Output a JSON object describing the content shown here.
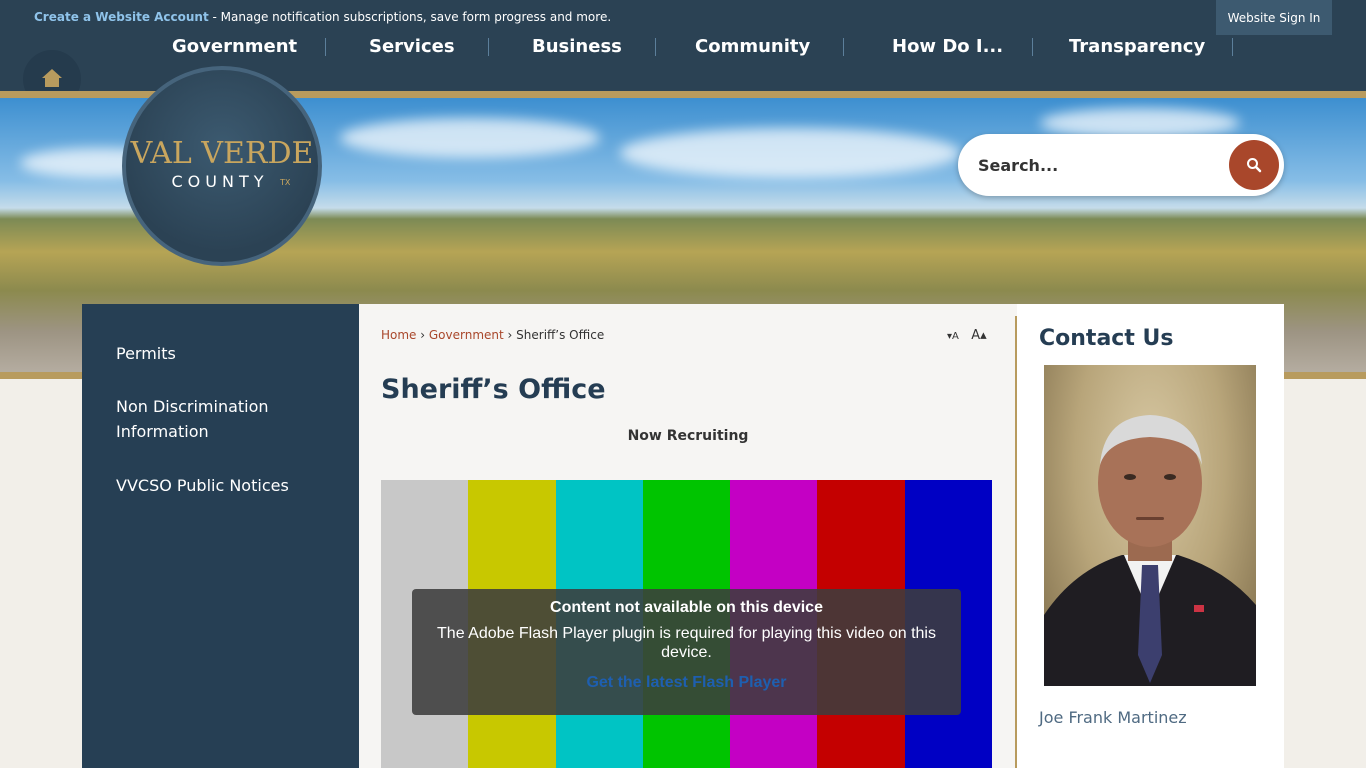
{
  "topbar": {
    "create_link": "Create a Website Account",
    "message": " - Manage notification subscriptions, save form progress and more.",
    "signin": "Website Sign In"
  },
  "nav": {
    "items": [
      "Government",
      "Services",
      "Business",
      "Community",
      "How Do I...",
      "Transparency"
    ]
  },
  "logo": {
    "line1": "VAL VERDE",
    "line2": "COUNTY",
    "state": "TX"
  },
  "search": {
    "placeholder": "Search..."
  },
  "sidebar": {
    "items": [
      "Permits",
      "Non Discrimination Information",
      "VVCSO Public Notices"
    ]
  },
  "breadcrumb": {
    "home": "Home",
    "sep1": " › ",
    "government": "Government",
    "sep2": " › ",
    "current": "Sheriff’s Office"
  },
  "text_resize": {
    "decrease": "▾A",
    "increase": "A▴"
  },
  "main": {
    "title": "Sheriff’s Office",
    "subtitle": "Now Recruiting"
  },
  "video": {
    "bar_colors": [
      "#c8c8c8",
      "#c8c800",
      "#00c4c4",
      "#00c400",
      "#c400c4",
      "#c40000",
      "#0000c4"
    ],
    "overlay_title": "Content not available on this device",
    "overlay_text": "The Adobe Flash Player plugin is required for playing this video on this device.",
    "overlay_link": "Get the latest Flash Player"
  },
  "contact": {
    "heading": "Contact Us",
    "name": "Joe Frank Martinez"
  },
  "colors": {
    "navy": "#2b4254",
    "gold": "#b89b5e",
    "accent": "#a9472b"
  }
}
